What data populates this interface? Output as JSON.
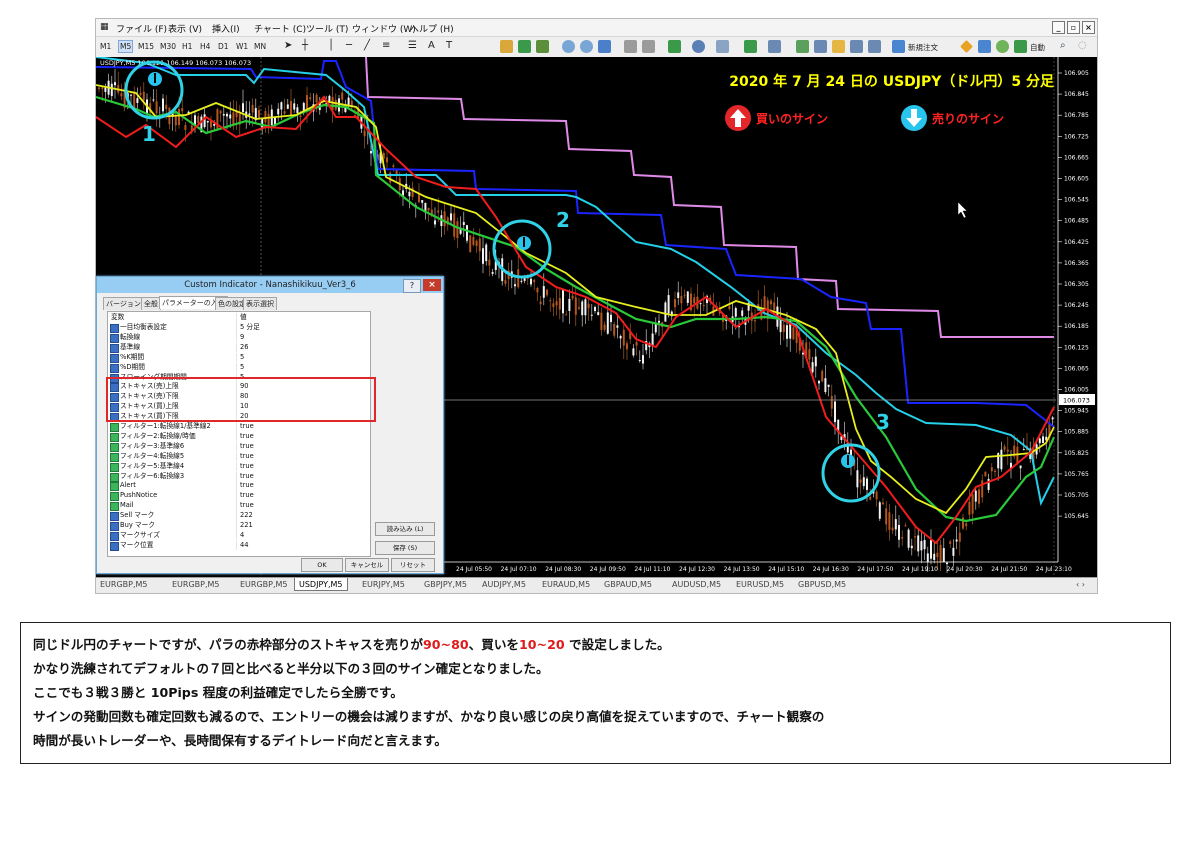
{
  "menu": {
    "items": [
      "ファイル (F)",
      "表示 (V)",
      "挿入(I)",
      "チャート (C)",
      "ツール (T)",
      "ウィンドウ (W)",
      "ヘルプ (H)"
    ]
  },
  "toolbar": {
    "timeframes": [
      "M1",
      "M5",
      "M15",
      "M30",
      "H1",
      "H4",
      "D1",
      "W1",
      "MN"
    ],
    "active_timeframe": "M5",
    "new_order_label": "新規注文",
    "auto_trading_label": "自動"
  },
  "chart": {
    "symbol_line": "USDJPY,M5  106.121 106.149 106.073 106.073",
    "overlay_title": "2020 年 7 月 24 日の USDJPY（ドル円）5 分足",
    "legend_buy": "買いのサイン",
    "legend_sell": "売りのサイン",
    "signal_labels": [
      "1",
      "2",
      "3"
    ],
    "current_price": "106.073",
    "price_axis": [
      "106.905",
      "106.845",
      "106.785",
      "106.725",
      "106.665",
      "106.605",
      "106.545",
      "106.485",
      "106.425",
      "106.365",
      "106.305",
      "106.245",
      "106.185",
      "106.125",
      "106.065",
      "106.005",
      "105.945",
      "105.885",
      "105.825",
      "105.765",
      "105.705",
      "105.645"
    ],
    "time_axis": [
      "24 Jul 05:50",
      "24 Jul 07:10",
      "24 Jul 08:30",
      "24 Jul 09:50",
      "24 Jul 11:10",
      "24 Jul 12:30",
      "24 Jul 13:50",
      "24 Jul 15:10",
      "24 Jul 16:30",
      "24 Jul 17:50",
      "24 Jul 19:10",
      "24 Jul 20:30",
      "24 Jul 21:50",
      "24 Jul 23:10"
    ],
    "colors": {
      "buy_arrow": "#e4262a",
      "sell_arrow": "#27c4ee",
      "overlay_title": "#ffff00",
      "legend_text": "#ff2020",
      "signal_circle": "#2fd2e6"
    }
  },
  "symbol_tabs": {
    "tabs": [
      "EURGBP,M5",
      "EURGBP,M5",
      "EURGBP,M5",
      "USDJPY,M5",
      "EURJPY,M5",
      "GBPJPY,M5",
      "AUDJPY,M5",
      "EURAUD,M5",
      "GBPAUD,M5",
      "AUDUSD,M5",
      "EURUSD,M5",
      "GBPUSD,M5"
    ],
    "active_index": 3
  },
  "dialog": {
    "title": "Custom Indicator - Nanashikikuu_Ver3_6",
    "tabs": [
      "バージョン情報",
      "全般",
      "パラメーターの入力",
      "色の設定",
      "表示選択"
    ],
    "active_tab": 2,
    "columns": {
      "name": "変数",
      "value": "値"
    },
    "rows": [
      {
        "icon": "ab",
        "name": "一目均衡表設定",
        "value": "5 分足"
      },
      {
        "icon": "123",
        "name": "転換線",
        "value": "9"
      },
      {
        "icon": "123",
        "name": "基準線",
        "value": "26"
      },
      {
        "icon": "123",
        "name": "%K期間",
        "value": "5"
      },
      {
        "icon": "123",
        "name": "%D期間",
        "value": "5"
      },
      {
        "icon": "123",
        "name": "スローイング期間期間",
        "value": "5"
      },
      {
        "icon": "123",
        "name": "ストキャス(売)上限",
        "value": "90"
      },
      {
        "icon": "123",
        "name": "ストキャス(売)下限",
        "value": "80"
      },
      {
        "icon": "123",
        "name": "ストキャス(買)上限",
        "value": "10"
      },
      {
        "icon": "123",
        "name": "ストキャス(買)下限",
        "value": "20"
      },
      {
        "icon": "bool",
        "name": "フィルター1:転換線1/基準線2",
        "value": "true"
      },
      {
        "icon": "bool",
        "name": "フィルター2:転換線/時価",
        "value": "true"
      },
      {
        "icon": "bool",
        "name": "フィルター3:基準線6",
        "value": "true"
      },
      {
        "icon": "bool",
        "name": "フィルター4:転換線5",
        "value": "true"
      },
      {
        "icon": "bool",
        "name": "フィルター5:基準線4",
        "value": "true"
      },
      {
        "icon": "bool",
        "name": "フィルター6:転換線3",
        "value": "true"
      },
      {
        "icon": "bool",
        "name": "Alert",
        "value": "true"
      },
      {
        "icon": "bool",
        "name": "PushNotice",
        "value": "true"
      },
      {
        "icon": "bool",
        "name": "Mail",
        "value": "true"
      },
      {
        "icon": "123",
        "name": "Sell マーク",
        "value": "222"
      },
      {
        "icon": "123",
        "name": "Buy マーク",
        "value": "221"
      },
      {
        "icon": "123",
        "name": "マークサイズ",
        "value": "4"
      },
      {
        "icon": "123",
        "name": "マーク位置",
        "value": "44"
      }
    ],
    "load_button": "読み込み (L)",
    "save_button": "保存 (S)",
    "ok_button": "OK",
    "cancel_button": "キャンセル",
    "reset_button": "リセット"
  },
  "caption": {
    "line1_a": "同じドル円のチャートですが、パラの赤枠部分のストキャスを売りが",
    "line1_sell": "90~80",
    "line1_b": "、買いを",
    "line1_buy": "10~20",
    "line1_c": "で設定しました。",
    "line2": "かなり洗練されてデフォルトの７回と比べると半分以下の３回のサイン確定となりました。",
    "line3": "ここでも３戦３勝と 10Pips 程度の利益確定でしたら全勝です。",
    "line4": "サインの発動回数も確定回数も減るので、エントリーの機会は減りますが、かなり良い感じの戻り高値を捉えていますので、チャート観察の",
    "line5": "時間が長いトレーダーや、長時間保有するデイトレード向だと言えます。"
  }
}
